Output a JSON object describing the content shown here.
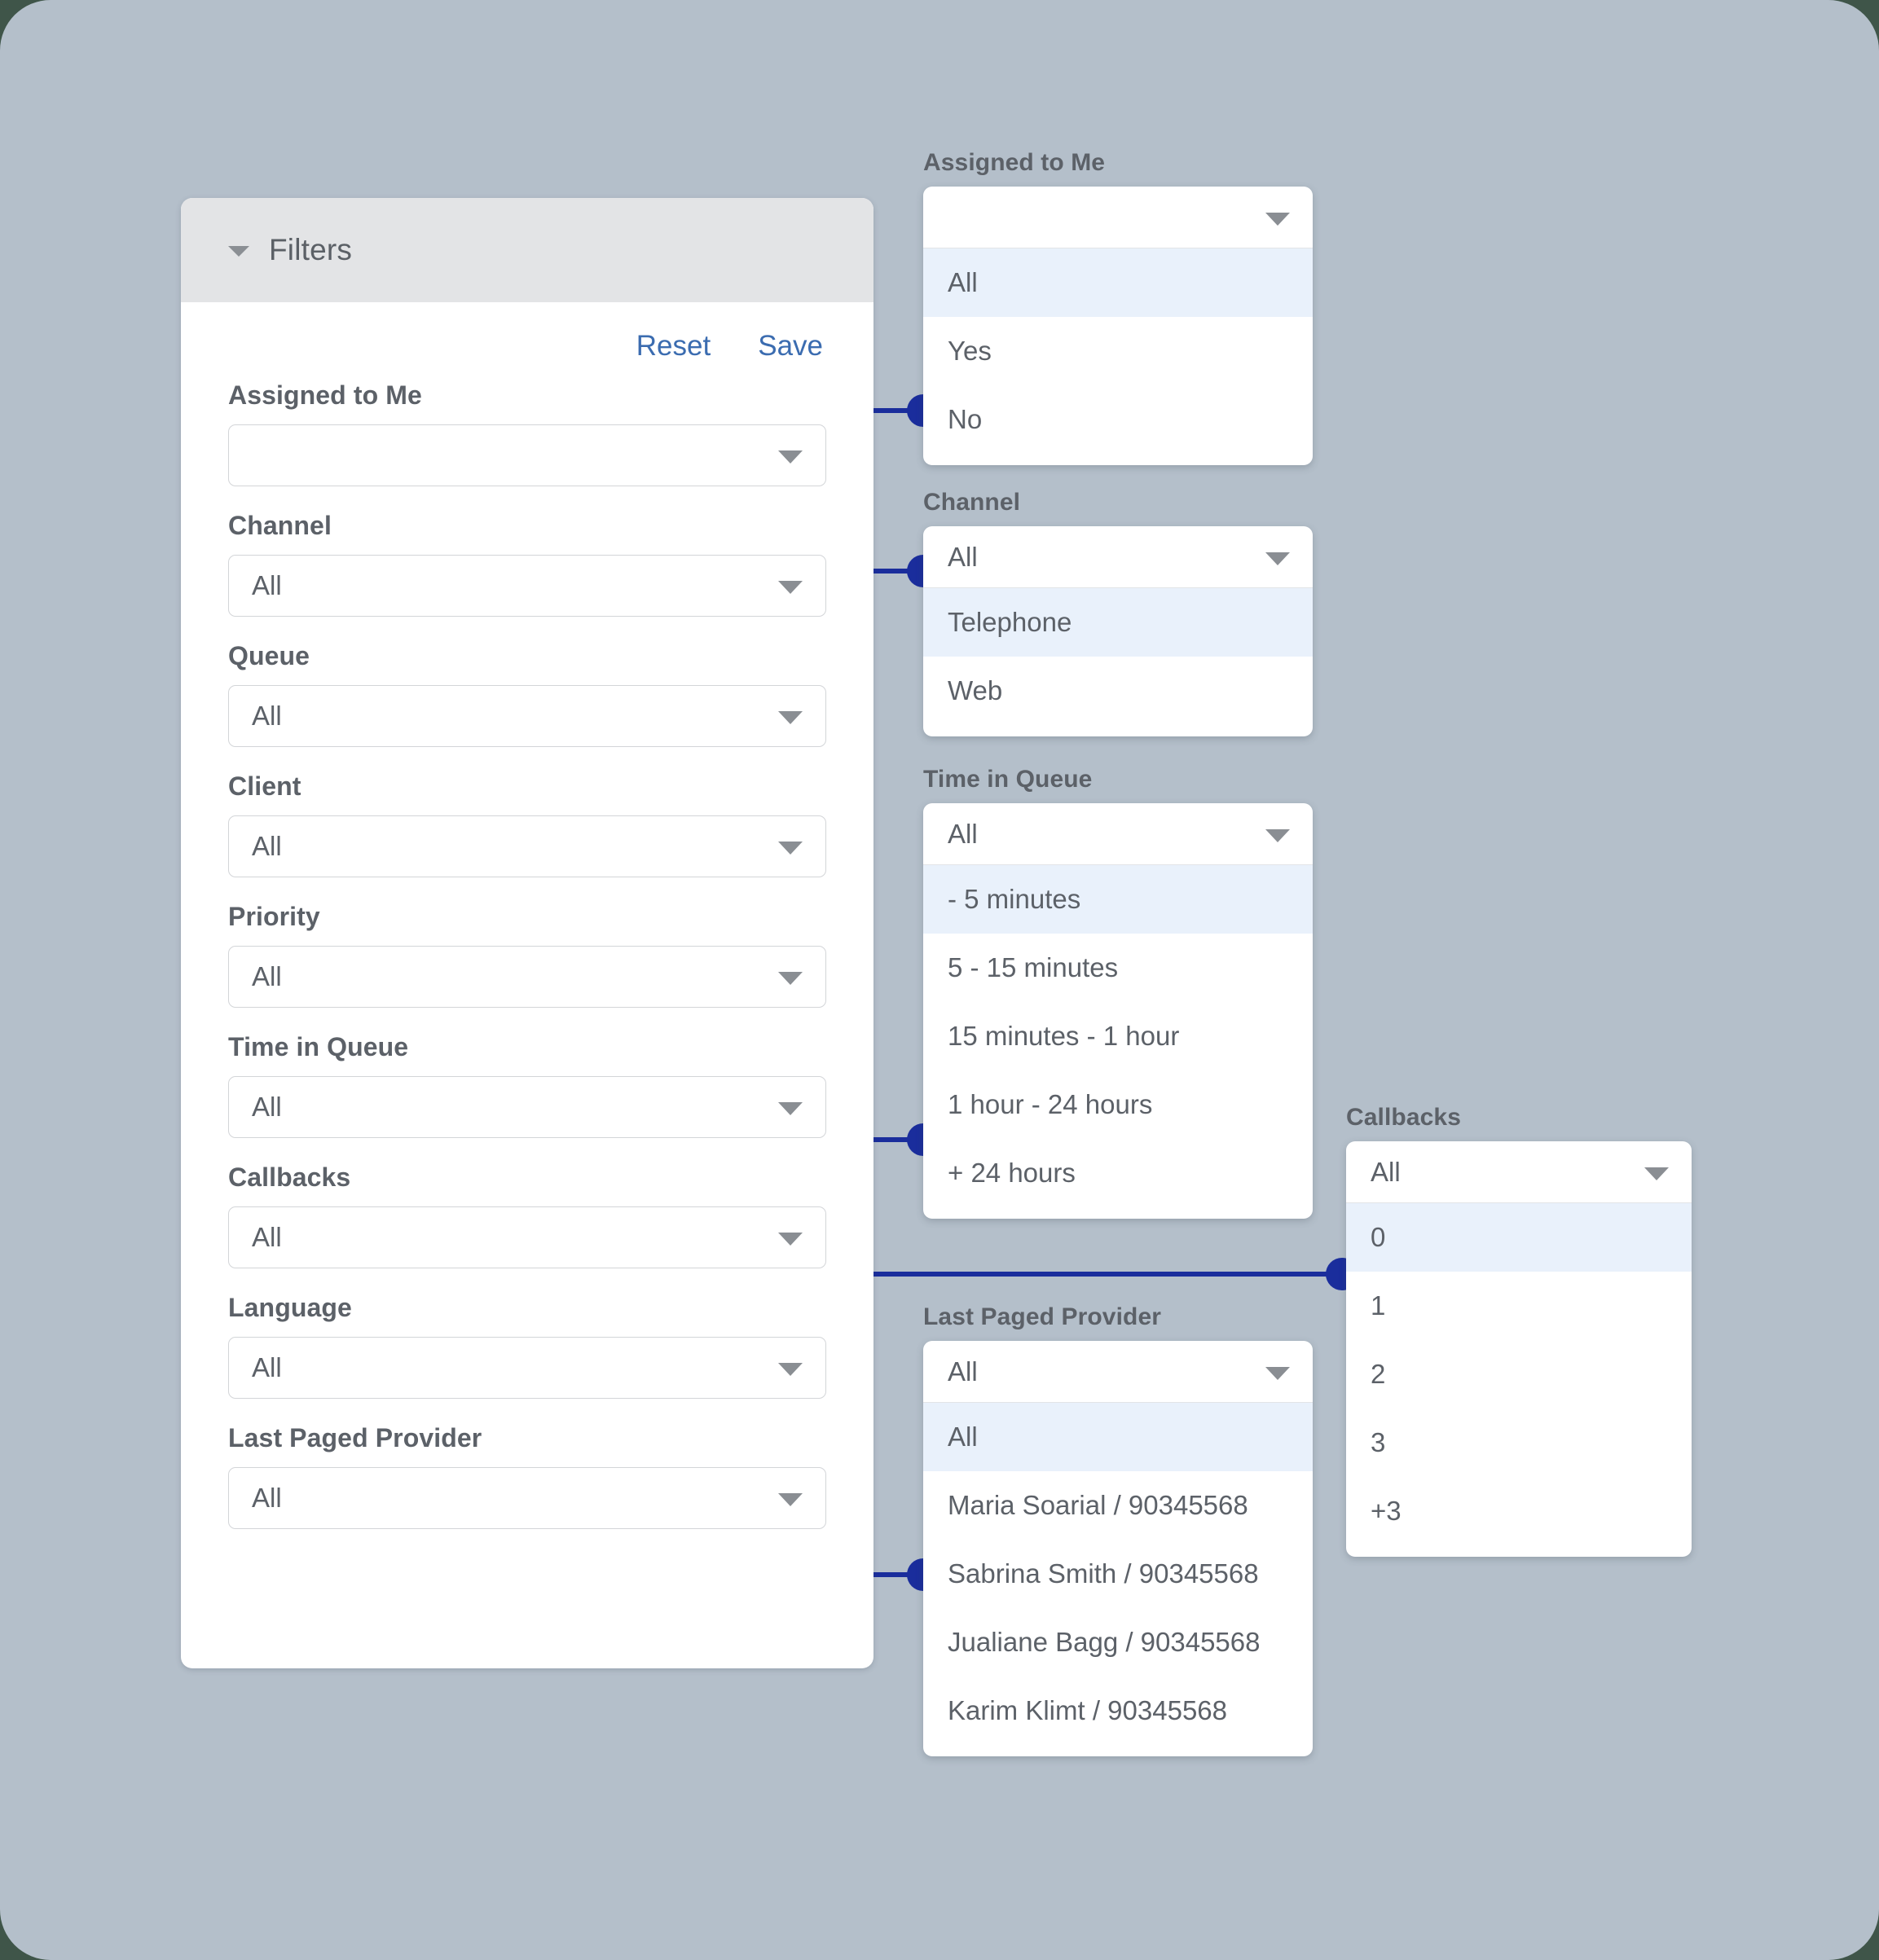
{
  "panel": {
    "title": "Filters",
    "reset_label": "Reset",
    "save_label": "Save",
    "fields": [
      {
        "label": "Assigned to Me",
        "value": ""
      },
      {
        "label": "Channel",
        "value": "All"
      },
      {
        "label": "Queue",
        "value": "All"
      },
      {
        "label": "Client",
        "value": "All"
      },
      {
        "label": "Priority",
        "value": "All"
      },
      {
        "label": "Time in Queue",
        "value": "All"
      },
      {
        "label": "Callbacks",
        "value": "All"
      },
      {
        "label": "Language",
        "value": "All"
      },
      {
        "label": "Last Paged Provider",
        "value": "All"
      }
    ]
  },
  "popovers": {
    "assigned_to_me": {
      "label": "Assigned to Me",
      "value": "",
      "options": [
        "All",
        "Yes",
        "No"
      ],
      "highlight_index": 0
    },
    "channel": {
      "label": "Channel",
      "value": "All",
      "options": [
        "Telephone",
        "Web"
      ],
      "highlight_index": 0
    },
    "time_in_queue": {
      "label": "Time in Queue",
      "value": "All",
      "options": [
        "- 5 minutes",
        "5 - 15 minutes",
        "15 minutes - 1 hour",
        "1 hour - 24 hours",
        "+ 24 hours"
      ],
      "highlight_index": 0
    },
    "callbacks": {
      "label": "Callbacks",
      "value": "All",
      "options": [
        "0",
        "1",
        "2",
        "3",
        "+3"
      ],
      "highlight_index": 0
    },
    "last_paged_provider": {
      "label": "Last Paged Provider",
      "value": "All",
      "options": [
        "All",
        "Maria Soarial / 90345568",
        "Sabrina Smith / 90345568",
        "Jualiane Bagg / 90345568",
        "Karim Klimt / 90345568"
      ],
      "highlight_index": 0
    }
  },
  "colors": {
    "canvas_background": "#b4bfca",
    "panel_header": "#e3e4e6",
    "link_blue": "#3b6cb0",
    "connector_blue": "#1a2d9c",
    "option_highlight": "#e9f1fb",
    "label_gray": "#5c6168"
  }
}
